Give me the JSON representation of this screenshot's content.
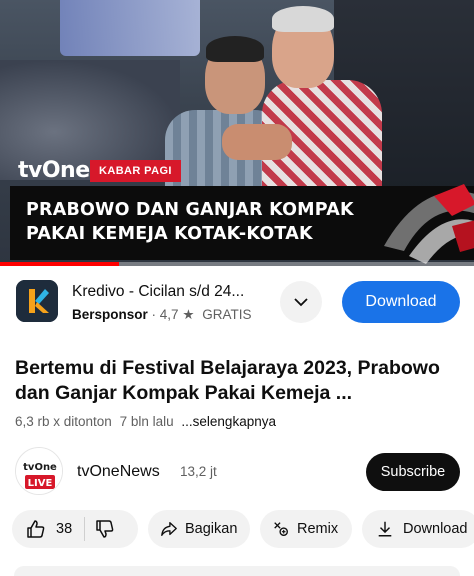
{
  "video": {
    "channel_logo": "tvOne",
    "segment_tag": "KABAR PAGI",
    "headline_line1": "PRABOWO DAN GANJAR KOMPAK",
    "headline_line2": "PAKAI KEMEJA KOTAK-KOTAK",
    "progress_fraction": 0.25
  },
  "ad": {
    "icon": "kredivo-k-icon",
    "title": "Kredivo - Cicilan s/d 24...",
    "sponsor_label": "Bersponsor",
    "rating": "4,7",
    "rating_icon": "star-icon",
    "price": "GRATIS",
    "expand_icon": "chevron-down-icon",
    "download_label": "Download",
    "accent_color": "#1a73e8"
  },
  "details": {
    "title": "Bertemu di Festival Belajaraya 2023, Prabowo dan Ganjar Kompak Pakai Kemeja ...",
    "views": "6,3 rb x ditonton",
    "age": "7 bln lalu",
    "more_label": "...selengkapnya"
  },
  "channel": {
    "avatar_text": "tvOne",
    "avatar_badge": "LIVE",
    "name": "tvOneNews",
    "subscribers": "13,2 jt",
    "subscribe_label": "Subscribe"
  },
  "actions": {
    "likes": "38",
    "like_icon": "thumbs-up-icon",
    "dislike_icon": "thumbs-down-icon",
    "share_label": "Bagikan",
    "share_icon": "share-arrow-icon",
    "remix_label": "Remix",
    "remix_icon": "remix-icon",
    "download_label": "Download",
    "download_icon": "download-arrow-icon"
  }
}
